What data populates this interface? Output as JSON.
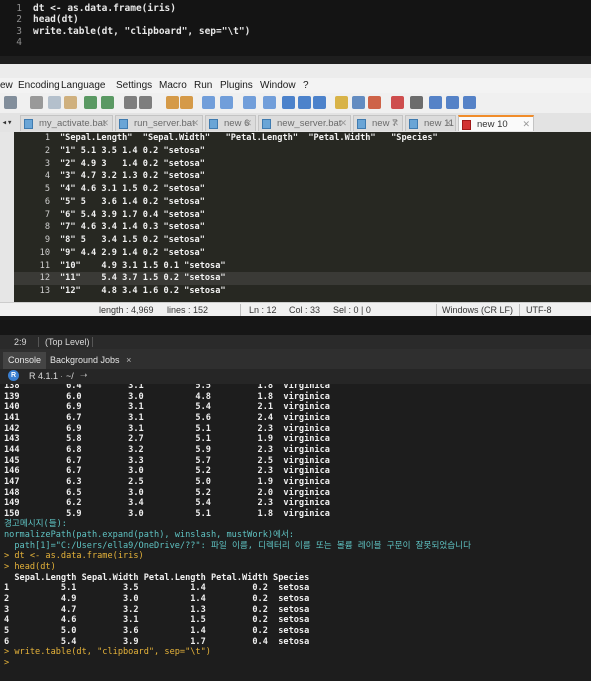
{
  "editor": {
    "lines": [
      {
        "num": "1",
        "code": "dt <- as.data.frame(iris)"
      },
      {
        "num": "2",
        "code": "head(dt)"
      },
      {
        "num": "3",
        "code": "write.table(dt, \"clipboard\", sep=\"\\t\")"
      },
      {
        "num": "4",
        "code": ""
      }
    ]
  },
  "npp": {
    "menu": [
      "ew",
      "Encoding",
      "Language",
      "Settings",
      "Macro",
      "Run",
      "Plugins",
      "Window",
      "?"
    ],
    "tabs": [
      "my_activate.bat",
      "run_server.bat",
      "new 6",
      "new_server.bat",
      "new 7",
      "new 11",
      "new 10"
    ],
    "active_tab": "new 10",
    "lines": [
      {
        "num": "1",
        "text": "\"Sepal.Length\"  \"Sepal.Width\"   \"Petal.Length\"  \"Petal.Width\"   \"Species\""
      },
      {
        "num": "2",
        "text": "\"1\" 5.1 3.5 1.4 0.2 \"setosa\""
      },
      {
        "num": "3",
        "text": "\"2\" 4.9 3   1.4 0.2 \"setosa\""
      },
      {
        "num": "4",
        "text": "\"3\" 4.7 3.2 1.3 0.2 \"setosa\""
      },
      {
        "num": "5",
        "text": "\"4\" 4.6 3.1 1.5 0.2 \"setosa\""
      },
      {
        "num": "6",
        "text": "\"5\" 5   3.6 1.4 0.2 \"setosa\""
      },
      {
        "num": "7",
        "text": "\"6\" 5.4 3.9 1.7 0.4 \"setosa\""
      },
      {
        "num": "8",
        "text": "\"7\" 4.6 3.4 1.4 0.3 \"setosa\""
      },
      {
        "num": "9",
        "text": "\"8\" 5   3.4 1.5 0.2 \"setosa\""
      },
      {
        "num": "10",
        "text": "\"9\" 4.4 2.9 1.4 0.2 \"setosa\""
      },
      {
        "num": "11",
        "text": "\"10\"    4.9 3.1 1.5 0.1 \"setosa\""
      },
      {
        "num": "12",
        "text": "\"11\"    5.4 3.7 1.5 0.2 \"setosa\""
      },
      {
        "num": "13",
        "text": "\"12\"    4.8 3.4 1.6 0.2 \"setosa\""
      }
    ],
    "status": {
      "length": "length : 4,969",
      "lines": "lines : 152",
      "ln": "Ln : 12",
      "col": "Col : 33",
      "sel": "Sel : 0 | 0",
      "eol": "Windows (CR LF)",
      "enc": "UTF-8"
    }
  },
  "rstudio": {
    "position": "2:9",
    "scope": "(Top Level)",
    "tabs": [
      "Console",
      "Background Jobs"
    ],
    "version": "R 4.1.1",
    "path": "~/",
    "console_lines": [
      {
        "text": "138         6.4         3.1          5.5         1.8  virginica",
        "style": ""
      },
      {
        "text": "139         6.0         3.0          4.8         1.8  virginica",
        "style": ""
      },
      {
        "text": "140         6.9         3.1          5.4         2.1  virginica",
        "style": ""
      },
      {
        "text": "141         6.7         3.1          5.6         2.4  virginica",
        "style": ""
      },
      {
        "text": "142         6.9         3.1          5.1         2.3  virginica",
        "style": ""
      },
      {
        "text": "143         5.8         2.7          5.1         1.9  virginica",
        "style": ""
      },
      {
        "text": "144         6.8         3.2          5.9         2.3  virginica",
        "style": ""
      },
      {
        "text": "145         6.7         3.3          5.7         2.5  virginica",
        "style": ""
      },
      {
        "text": "146         6.7         3.0          5.2         2.3  virginica",
        "style": ""
      },
      {
        "text": "147         6.3         2.5          5.0         1.9  virginica",
        "style": ""
      },
      {
        "text": "148         6.5         3.0          5.2         2.0  virginica",
        "style": ""
      },
      {
        "text": "149         6.2         3.4          5.4         2.3  virginica",
        "style": ""
      },
      {
        "text": "150         5.9         3.0          5.1         1.8  virginica",
        "style": ""
      },
      {
        "text": "경고메시지(들):",
        "style": "warn"
      },
      {
        "text": "normalizePath(path.expand(path), winslash, mustWork)에서:",
        "style": "warn"
      },
      {
        "text": "  path[1]=\"C:/Users/ella9/OneDrive/??\": 파일 이름, 디렉터리 이름 또는 볼륨 레이블 구문이 잘못되었습니다",
        "style": "warn"
      },
      {
        "text": "> dt <- as.data.frame(iris)",
        "style": "cmd"
      },
      {
        "text": "> head(dt)",
        "style": "cmd"
      },
      {
        "text": "  Sepal.Length Sepal.Width Petal.Length Petal.Width Species",
        "style": ""
      },
      {
        "text": "1          5.1         3.5          1.4         0.2  setosa",
        "style": ""
      },
      {
        "text": "2          4.9         3.0          1.4         0.2  setosa",
        "style": ""
      },
      {
        "text": "3          4.7         3.2          1.3         0.2  setosa",
        "style": ""
      },
      {
        "text": "4          4.6         3.1          1.5         0.2  setosa",
        "style": ""
      },
      {
        "text": "5          5.0         3.6          1.4         0.2  setosa",
        "style": ""
      },
      {
        "text": "6          5.4         3.9          1.7         0.4  setosa",
        "style": ""
      },
      {
        "text": "> write.table(dt, \"clipboard\", sep=\"\\t\")",
        "style": "cmd"
      },
      {
        "text": ">",
        "style": "cmd"
      }
    ]
  },
  "colors": {
    "editor_bg": "#272822",
    "console_bg": "#1d1d1d",
    "prompt": "#e6b33a",
    "warning": "#5fc3c3",
    "active_tab_accent": "#f08c2a"
  }
}
